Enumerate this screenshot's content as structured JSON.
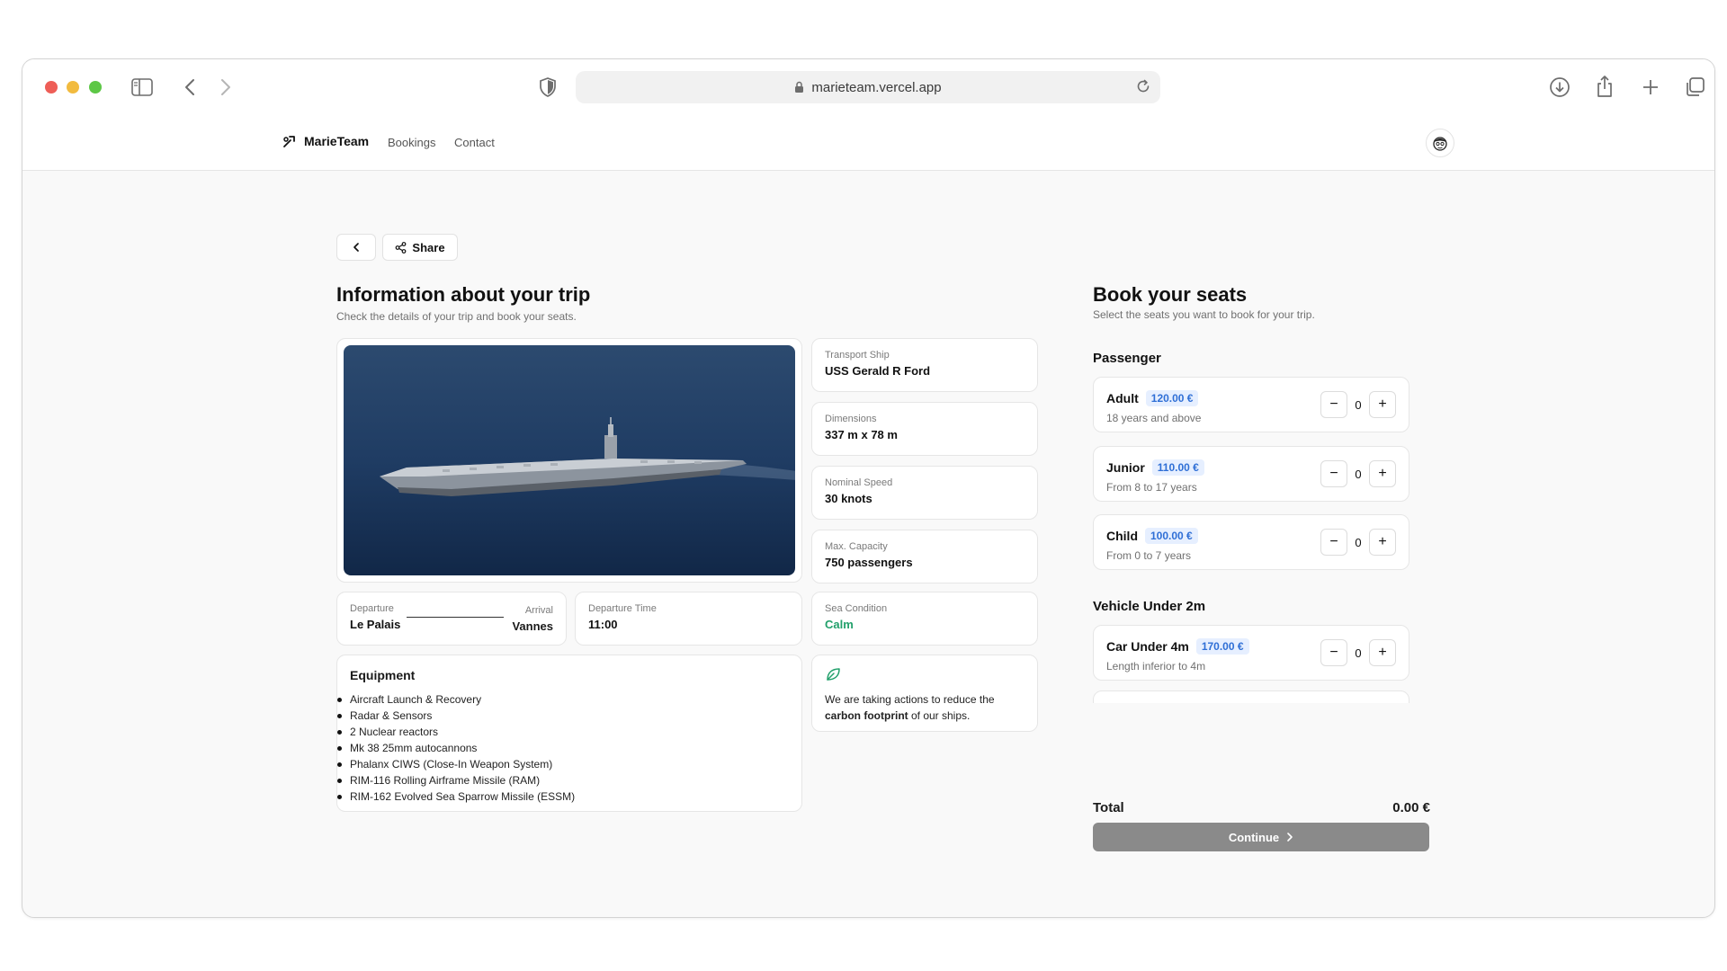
{
  "browser": {
    "url": "marieteam.vercel.app"
  },
  "nav": {
    "brand": "MarieTeam",
    "links": [
      "Bookings",
      "Contact"
    ]
  },
  "toolbar": {
    "share_label": "Share"
  },
  "trip": {
    "title": "Information about your trip",
    "subtitle": "Check the details of your trip and book your seats.",
    "specs": [
      {
        "label": "Transport Ship",
        "value": "USS Gerald R Ford"
      },
      {
        "label": "Dimensions",
        "value": "337 m x 78 m"
      },
      {
        "label": "Nominal Speed",
        "value": "30 knots"
      },
      {
        "label": "Max. Capacity",
        "value": "750 passengers"
      }
    ],
    "route": {
      "departure_label": "Departure",
      "departure": "Le Palais",
      "arrival_label": "Arrival",
      "arrival": "Vannes"
    },
    "departure_time": {
      "label": "Departure Time",
      "value": "11:00"
    },
    "sea_condition": {
      "label": "Sea Condition",
      "value": "Calm",
      "color": "#22a06b"
    },
    "equipment": {
      "title": "Equipment",
      "items": [
        "Aircraft Launch & Recovery",
        "Radar & Sensors",
        "2 Nuclear reactors",
        "Mk 38 25mm autocannons",
        "Phalanx CIWS (Close-In Weapon System)",
        "RIM-116 Rolling Airframe Missile (RAM)",
        "RIM-162 Evolved Sea Sparrow Missile (ESSM)"
      ]
    },
    "eco": {
      "text_before": "We are taking actions to reduce the ",
      "text_bold": "carbon footprint",
      "text_after": " of our ships.",
      "icon": "leaf-icon"
    }
  },
  "booking": {
    "title": "Book your seats",
    "subtitle": "Select the seats you want to book for your trip.",
    "passenger_title": "Passenger",
    "passengers": [
      {
        "name": "Adult",
        "price": "120.00 €",
        "desc": "18 years and above",
        "count": "0"
      },
      {
        "name": "Junior",
        "price": "110.00 €",
        "desc": "From 8 to 17 years",
        "count": "0"
      },
      {
        "name": "Child",
        "price": "100.00 €",
        "desc": "From 0 to 7 years",
        "count": "0"
      }
    ],
    "vehicle_title": "Vehicle Under 2m",
    "vehicles": [
      {
        "name": "Car Under 4m",
        "price": "170.00 €",
        "desc": "Length inferior to 4m",
        "count": "0"
      }
    ],
    "total_label": "Total",
    "total_value": "0.00 €",
    "continue_label": "Continue",
    "accent": "#2f6fd6"
  }
}
